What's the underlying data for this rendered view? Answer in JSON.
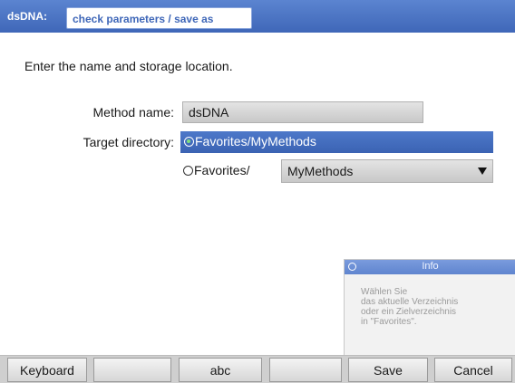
{
  "header": {
    "app_name": "dsDNA:",
    "title": "check parameters / save as"
  },
  "main": {
    "instruction": "Enter the name and storage location.",
    "method_label": "Method name:",
    "method_value": "dsDNA",
    "target_label": "Target directory:",
    "option_default": "Favorites/MyMethods",
    "option_custom_prefix": "Favorites/",
    "directory_selected": "MyMethods"
  },
  "info": {
    "title": "Info",
    "lines": [
      "Wählen Sie",
      "das aktuelle Verzeichnis",
      "oder ein Zielverzeichnis",
      "in \"Favorites\"."
    ]
  },
  "buttons": {
    "keyboard": "Keyboard",
    "blank1": "",
    "abc": "abc",
    "blank2": "",
    "save": "Save",
    "cancel": "Cancel"
  },
  "colors": {
    "accent": "#3f67b8",
    "selection": "#4d78c9"
  }
}
